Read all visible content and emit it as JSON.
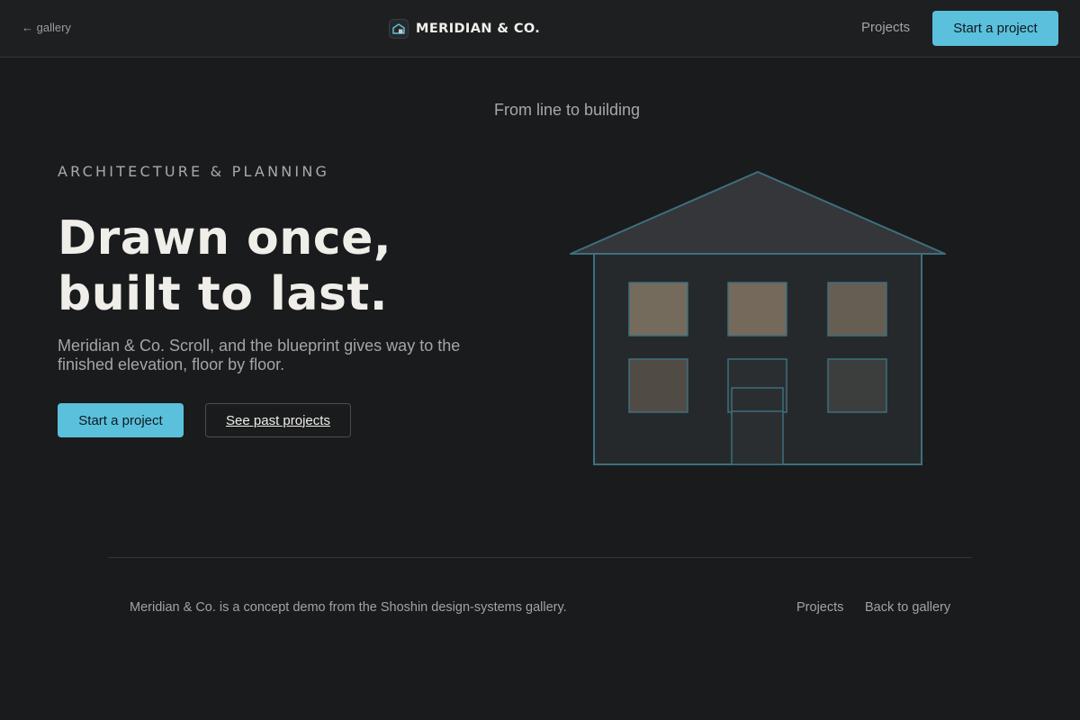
{
  "header": {
    "back_label": "← gallery",
    "brand_name": "MERIDIAN & CO.",
    "brand_icon": "house-icon",
    "nav_projects": "Projects",
    "cta_label": "Start a project"
  },
  "hero": {
    "eyebrow": "From line to building",
    "kicker": "ARCHITECTURE & PLANNING",
    "headline_line1": "Drawn once,",
    "headline_line2": "built to last.",
    "lede": "Meridian & Co. Scroll, and the blueprint gives way to the finished elevation, floor by floor.",
    "primary_cta": "Start a project",
    "secondary_cta": "See past projects",
    "illustration": "building-elevation-icon"
  },
  "footer": {
    "note": "Meridian & Co. is a concept demo from the Shoshin design-systems gallery.",
    "link_projects": "Projects",
    "link_gallery": "Back to gallery"
  },
  "colors": {
    "background": "#1a1b1d",
    "header_background": "#1e1f21",
    "accent": "#5bc0dc",
    "blueprint_line": "#3d6f7e",
    "window_fill": "#6e665a"
  }
}
